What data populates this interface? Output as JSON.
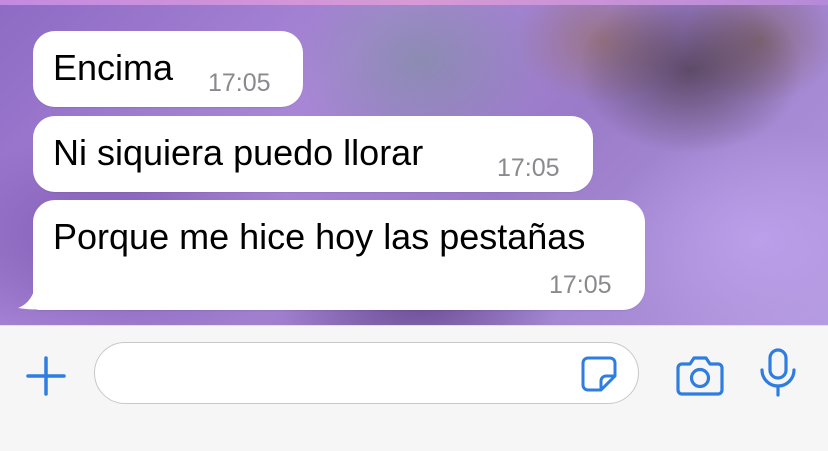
{
  "chat": {
    "messages": [
      {
        "text": "Encima",
        "time": "17:05"
      },
      {
        "text": "Ni siquiera puedo llorar",
        "time": "17:05"
      },
      {
        "text": "Porque me hice hoy las pestañas",
        "time": "17:05"
      }
    ]
  },
  "input_bar": {
    "message_value": "",
    "icons": {
      "attach": "plus-icon",
      "sticker": "sticker-icon",
      "camera": "camera-icon",
      "microphone": "microphone-icon"
    }
  },
  "colors": {
    "accent": "#2f7ddf",
    "bubble_bg": "#ffffff",
    "time_text": "#8a8a8e",
    "input_bar_bg": "#f6f6f6",
    "wallpaper_purple": "#9a7bc9"
  }
}
